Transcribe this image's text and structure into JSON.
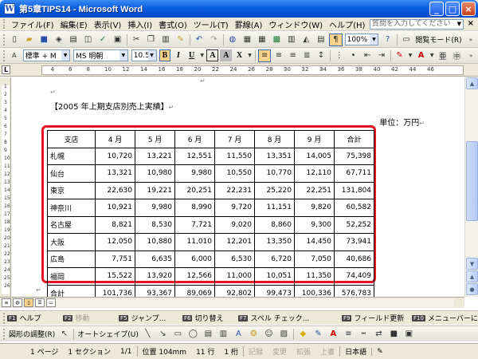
{
  "window": {
    "title": "第5章TIPS14 - Microsoft Word",
    "app_icon": "W",
    "minimize": "_",
    "maximize": "□",
    "close": "×"
  },
  "menu": {
    "items": [
      "ファイル(F)",
      "編集(E)",
      "表示(V)",
      "挿入(I)",
      "書式(O)",
      "ツール(T)",
      "罫線(A)",
      "ウィンドウ(W)",
      "ヘルプ(H)"
    ],
    "help_placeholder": "質問を入力してください",
    "close": "×"
  },
  "toolbar_standard": {
    "zoom": "100%",
    "read_mode": "閲覧モード(R)"
  },
  "toolbar_format": {
    "style": "標準 + M",
    "font": "MS 明朝",
    "size": "10.5",
    "bold": "B",
    "italic": "I",
    "underline": "U"
  },
  "ruler": {
    "numbers": [
      "2",
      "4",
      "6",
      "8",
      "10",
      "12",
      "14",
      "16",
      "18",
      "20",
      "22",
      "24",
      "26",
      "28",
      "30",
      "32",
      "34",
      "36",
      "38",
      "40",
      "42",
      "44",
      "46"
    ],
    "tab_selector": "L"
  },
  "vruler": {
    "numbers": [
      "1",
      "2",
      "3",
      "4",
      "5",
      "6",
      "7",
      "8",
      "9",
      "10",
      "11",
      "12",
      "13",
      "14",
      "15",
      "16",
      "17",
      "18",
      "19",
      "20",
      "21",
      "22",
      "23",
      "24",
      "25",
      "26"
    ]
  },
  "document": {
    "heading": "【2005 年上期支店別売上実績】",
    "unit": "単位：万円",
    "paragraph_mark": "↵"
  },
  "table": {
    "headers": [
      "支店",
      "4 月",
      "5 月",
      "6 月",
      "7 月",
      "8 月",
      "9 月",
      "合計"
    ],
    "rows": [
      [
        "札幌",
        "10,720",
        "13,221",
        "12,551",
        "11,550",
        "13,351",
        "14,005",
        "75,398"
      ],
      [
        "仙台",
        "13,321",
        "10,980",
        "9,980",
        "10,550",
        "10,770",
        "12,110",
        "67,711"
      ],
      [
        "東京",
        "22,630",
        "19,221",
        "20,251",
        "22,231",
        "25,220",
        "22,251",
        "131,804"
      ],
      [
        "神奈川",
        "10,921",
        "9,980",
        "8,990",
        "9,720",
        "11,151",
        "9,820",
        "60,582"
      ],
      [
        "名古屋",
        "8,821",
        "8,530",
        "7,721",
        "9,020",
        "8,860",
        "9,300",
        "52,252"
      ],
      [
        "大阪",
        "12,050",
        "10,880",
        "11,010",
        "12,201",
        "13,350",
        "14,450",
        "73,941"
      ],
      [
        "広島",
        "7,751",
        "6,635",
        "6,000",
        "6,530",
        "6,720",
        "7,050",
        "40,686"
      ],
      [
        "福岡",
        "15,522",
        "13,920",
        "12,566",
        "11,000",
        "10,051",
        "11,350",
        "74,409"
      ],
      [
        "合計",
        "101,736",
        "93,367",
        "89,069",
        "92,802",
        "99,473",
        "100,336",
        "576,783"
      ]
    ]
  },
  "fkeys": [
    {
      "key": "F1",
      "label": "ヘルプ",
      "enabled": true
    },
    {
      "key": "F2",
      "label": "移動",
      "enabled": false
    },
    {
      "key": "F5",
      "label": "ジャンプ...",
      "enabled": true
    },
    {
      "key": "F6",
      "label": "切り替え",
      "enabled": true
    },
    {
      "key": "F7",
      "label": "スペル チェック...",
      "enabled": true
    },
    {
      "key": "F9",
      "label": "フィールド更新",
      "enabled": true
    },
    {
      "key": "F10",
      "label": "メニューバーに",
      "enabled": true
    }
  ],
  "drawing": {
    "arrange": "図形の調整(R)",
    "autoshape": "オートシェイプ(U)"
  },
  "status": {
    "page": "1 ページ",
    "section": "1 セクション",
    "pages": "1/1",
    "position": "位置 104mm",
    "line": "11 行",
    "column": "1 桁",
    "rec": "記録",
    "trk": "変更",
    "ext": "拡張",
    "ovr": "上書",
    "lang": "日本語"
  }
}
